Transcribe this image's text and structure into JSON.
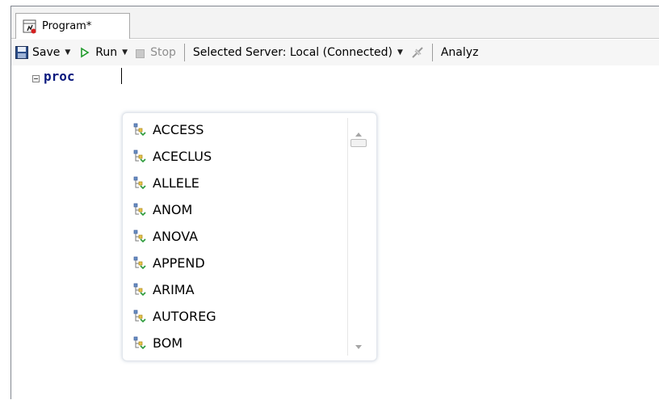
{
  "tab": {
    "label": "Program*"
  },
  "toolbar": {
    "save_label": "Save",
    "run_label": "Run",
    "stop_label": "Stop",
    "server_label": "Selected Server: Local (Connected)",
    "analyze_label": "Analyz"
  },
  "editor": {
    "code": "proc",
    "keyword_color": "#0b1a7e"
  },
  "autocomplete": {
    "items": [
      {
        "label": "ACCESS"
      },
      {
        "label": "ACECLUS"
      },
      {
        "label": "ALLELE"
      },
      {
        "label": "ANOM"
      },
      {
        "label": "ANOVA"
      },
      {
        "label": "APPEND"
      },
      {
        "label": "ARIMA"
      },
      {
        "label": "AUTOREG"
      },
      {
        "label": "BOM"
      }
    ],
    "item_icon": "procedure-icon"
  }
}
